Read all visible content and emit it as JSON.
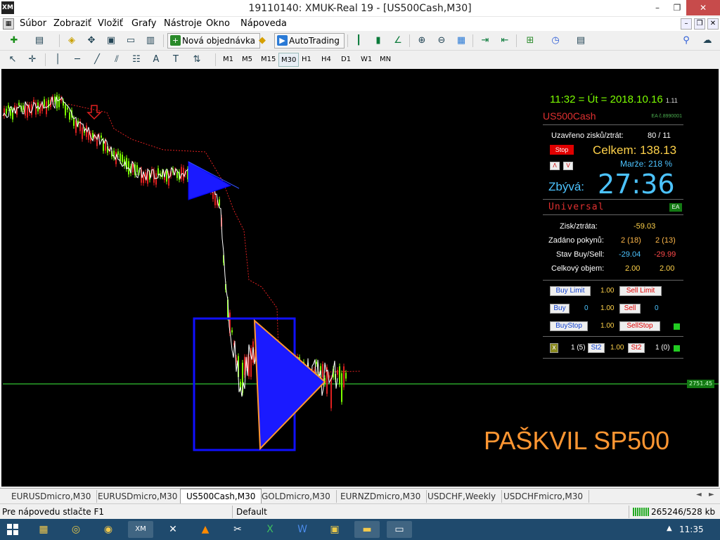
{
  "window": {
    "title": "19110140: XMUK-Real 19 - [US500Cash,M30]",
    "app_icon": "XM",
    "minimize_glyph": "–",
    "maximize_glyph": "❐",
    "close_glyph": "✕"
  },
  "menu": {
    "items": [
      "Súbor",
      "Zobraziť",
      "Vložiť",
      "Grafy",
      "Nástroje",
      "Okno",
      "Nápoveda"
    ],
    "mdi_minimize": "–",
    "mdi_restore": "❐",
    "mdi_close": "✕"
  },
  "toolbar": {
    "new_order_label": "Nová objednávka",
    "autotrading_label": "AutoTrading",
    "timeframes": [
      "M1",
      "M5",
      "M15",
      "M30",
      "H1",
      "H4",
      "D1",
      "W1",
      "MN"
    ],
    "active_timeframe": "M30",
    "icons": [
      "new-chart-icon",
      "profiles-icon",
      "market-watch-icon",
      "navigator-icon",
      "data-window-icon",
      "terminal-icon",
      "strategy-tester-icon",
      "metaeditor-icon",
      "bar-chart-icon",
      "candlestick-icon",
      "line-chart-icon",
      "zoom-in-icon",
      "zoom-out-icon",
      "tile-windows-icon",
      "auto-scroll-icon",
      "chart-shift-icon",
      "indicators-icon",
      "periods-icon",
      "templates-icon",
      "search-icon",
      "chat-icon",
      "cursor-icon",
      "crosshair-icon",
      "vertical-line-icon",
      "horizontal-line-icon",
      "trendline-icon",
      "equidistant-channel-icon",
      "fibonacci-icon",
      "text-icon",
      "text-label-icon",
      "arrows-icon"
    ]
  },
  "chart": {
    "watermark": "PAŠKVIL SP500",
    "price_tag": "2751.45",
    "panel": {
      "clock": "11:32 = Út = 2018.10.16",
      "clock_suffix": "1.11",
      "symbol": "US500Cash",
      "ea_id": "EA č.8990001",
      "closed_label": "Uzavřeno zisků/ztrát:",
      "closed_value": "80 / 11",
      "stop_label": "Stop",
      "celkem": "Celkem: 138.13",
      "a_label": "Λ",
      "v_label": "V",
      "marze": "Marže:  218 %",
      "zbyva_label": "Zbývá:",
      "zbyva_value": "27:36",
      "universal": "Universal",
      "ea_label": "EA",
      "zisk_label": "Zisk/ztráta:",
      "zisk_value": "-59.03",
      "zadano_label": "Zadáno pokynů:",
      "zadano_buy": "2 (18)",
      "zadano_sell": "2 (13)",
      "stav_label": "Stav Buy/Sell:",
      "stav_buy": "-29.04",
      "stav_sell": "-29.99",
      "objem_label": "Celkový objem:",
      "objem_buy": "2.00",
      "objem_sell": "2.00",
      "buy_limit": "Buy Limit",
      "buy_limit_lot": "1.00",
      "sell_limit": "Sell Limit",
      "buy": "Buy",
      "buy_count": "0",
      "buy_lot": "1.00",
      "sell": "Sell",
      "sell_count": "0",
      "buy_stop": "BuyStop",
      "buy_stop_lot": "1.00",
      "sell_stop": "SellStop",
      "x_label": "x",
      "s1_count": "1 (5)",
      "st2a": "St2",
      "st2_lot": "1.00",
      "st2b": "St2",
      "s2_count": "1 (0)"
    },
    "colors": {
      "background": "#000000",
      "horizontal_line": "#1f7a1f",
      "triangle_fill": "#1a1aff",
      "triangle_edge": "#ff9632",
      "bull": "#7cfc00",
      "bear": "#e02020",
      "close_line": "#ffffff",
      "stop_line": "#e02020"
    }
  },
  "tabs": {
    "items": [
      "EURUSDmicro,M30",
      "EURUSDmicro,M30",
      "US500Cash,M30",
      "GOLDmicro,M30",
      "EURNZDmicro,M30",
      "USDCHF,Weekly",
      "USDCHFmicro,M30"
    ],
    "active": "US500Cash,M30",
    "left_arrow": "◄",
    "right_arrow": "►"
  },
  "status": {
    "help": "Pre nápovedu stlačte F1",
    "profile": "Default",
    "traffic": "265246/528 kb"
  },
  "taskbar": {
    "apps": [
      "explorer-icon",
      "globe-icon",
      "chrome-icon",
      "xm-terminal-icon",
      "xm-alt-icon",
      "vlc-icon",
      "capture-icon",
      "excel-icon",
      "word-icon",
      "picture-icon",
      "folder-icon",
      "remote-desktop-icon"
    ],
    "tray_arrow": "▲",
    "clock": "11:35"
  }
}
